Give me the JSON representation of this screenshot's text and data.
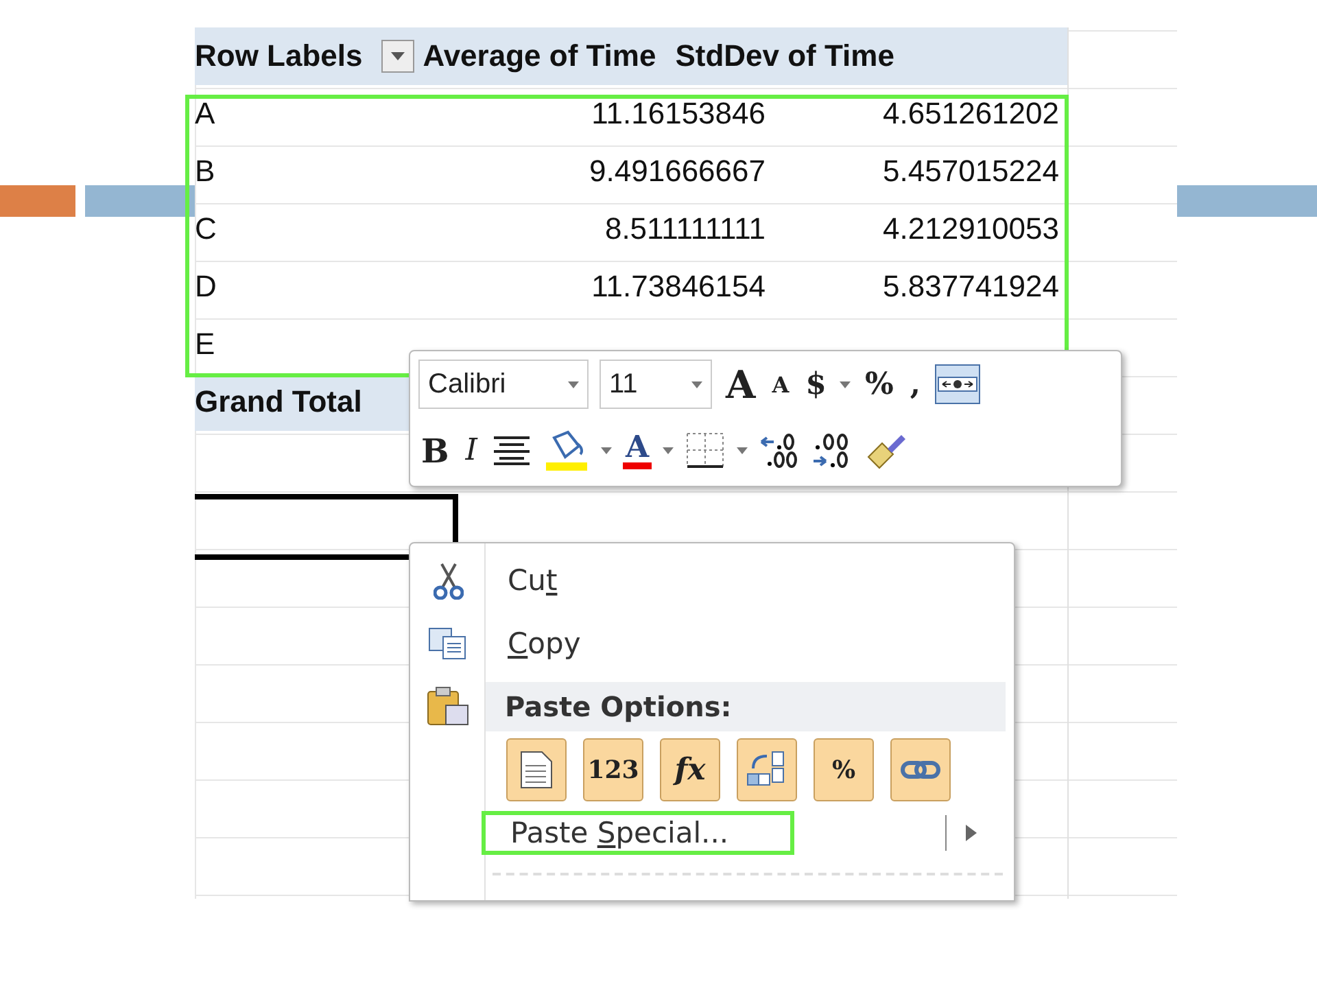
{
  "pivot": {
    "header": {
      "row_labels": "Row Labels",
      "column_2": "Average of Time",
      "column_3": "StdDev of Time"
    },
    "rows": [
      {
        "label": "A",
        "average": "11.16153846",
        "stddev": "4.651261202"
      },
      {
        "label": "B",
        "average": "9.491666667",
        "stddev": "5.457015224"
      },
      {
        "label": "C",
        "average": "8.511111111",
        "stddev": "4.212910053"
      },
      {
        "label": "D",
        "average": "11.73846154",
        "stddev": "5.837741924"
      },
      {
        "label": "E"
      }
    ],
    "grand_total": "Grand Total"
  },
  "mini_toolbar": {
    "font": "Calibri",
    "size": "11",
    "row_1": [
      {
        "kind": "grow",
        "text": "A"
      },
      {
        "kind": "shrink",
        "text": "A"
      },
      {
        "kind": "currency",
        "text": "$"
      },
      {
        "kind": "text",
        "text": "%"
      },
      {
        "kind": "text",
        "text": ","
      },
      {
        "kind": "merge"
      }
    ],
    "row_2": [
      {
        "kind": "bold",
        "text": "B"
      },
      {
        "kind": "italic",
        "text": "I"
      },
      {
        "kind": "center"
      },
      {
        "kind": "fill"
      },
      {
        "kind": "fontcolor",
        "text": "A"
      },
      {
        "kind": "borders"
      },
      {
        "kind": "decrease"
      },
      {
        "kind": "increase"
      },
      {
        "kind": "brush"
      }
    ]
  },
  "context_menu": {
    "items": [
      {
        "kind": "cut",
        "before": "Cu",
        "accel": "t"
      },
      {
        "kind": "copy",
        "accel": "C",
        "after": "opy"
      },
      {
        "kind": "header",
        "text": "Paste Options:"
      },
      {
        "kind": "options",
        "options": [
          {
            "kind": "doc"
          },
          {
            "kind": "text",
            "label": "123"
          },
          {
            "kind": "italic",
            "label": "fx"
          },
          {
            "kind": "transpose"
          },
          {
            "kind": "text",
            "label": "%"
          },
          {
            "kind": "link"
          }
        ]
      },
      {
        "kind": "submenu",
        "before": "Paste ",
        "accel": "S",
        "after": "pecial...",
        "highlighted": true
      }
    ]
  }
}
